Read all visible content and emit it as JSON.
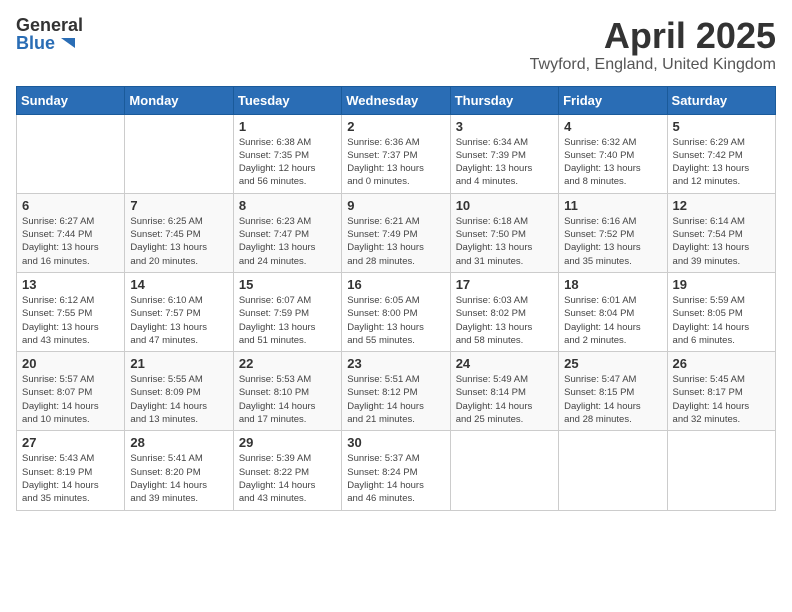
{
  "header": {
    "logo_general": "General",
    "logo_blue": "Blue",
    "month_title": "April 2025",
    "location": "Twyford, England, United Kingdom"
  },
  "calendar": {
    "days_of_week": [
      "Sunday",
      "Monday",
      "Tuesday",
      "Wednesday",
      "Thursday",
      "Friday",
      "Saturday"
    ],
    "weeks": [
      [
        {
          "day": "",
          "info": ""
        },
        {
          "day": "",
          "info": ""
        },
        {
          "day": "1",
          "info": "Sunrise: 6:38 AM\nSunset: 7:35 PM\nDaylight: 12 hours\nand 56 minutes."
        },
        {
          "day": "2",
          "info": "Sunrise: 6:36 AM\nSunset: 7:37 PM\nDaylight: 13 hours\nand 0 minutes."
        },
        {
          "day": "3",
          "info": "Sunrise: 6:34 AM\nSunset: 7:39 PM\nDaylight: 13 hours\nand 4 minutes."
        },
        {
          "day": "4",
          "info": "Sunrise: 6:32 AM\nSunset: 7:40 PM\nDaylight: 13 hours\nand 8 minutes."
        },
        {
          "day": "5",
          "info": "Sunrise: 6:29 AM\nSunset: 7:42 PM\nDaylight: 13 hours\nand 12 minutes."
        }
      ],
      [
        {
          "day": "6",
          "info": "Sunrise: 6:27 AM\nSunset: 7:44 PM\nDaylight: 13 hours\nand 16 minutes."
        },
        {
          "day": "7",
          "info": "Sunrise: 6:25 AM\nSunset: 7:45 PM\nDaylight: 13 hours\nand 20 minutes."
        },
        {
          "day": "8",
          "info": "Sunrise: 6:23 AM\nSunset: 7:47 PM\nDaylight: 13 hours\nand 24 minutes."
        },
        {
          "day": "9",
          "info": "Sunrise: 6:21 AM\nSunset: 7:49 PM\nDaylight: 13 hours\nand 28 minutes."
        },
        {
          "day": "10",
          "info": "Sunrise: 6:18 AM\nSunset: 7:50 PM\nDaylight: 13 hours\nand 31 minutes."
        },
        {
          "day": "11",
          "info": "Sunrise: 6:16 AM\nSunset: 7:52 PM\nDaylight: 13 hours\nand 35 minutes."
        },
        {
          "day": "12",
          "info": "Sunrise: 6:14 AM\nSunset: 7:54 PM\nDaylight: 13 hours\nand 39 minutes."
        }
      ],
      [
        {
          "day": "13",
          "info": "Sunrise: 6:12 AM\nSunset: 7:55 PM\nDaylight: 13 hours\nand 43 minutes."
        },
        {
          "day": "14",
          "info": "Sunrise: 6:10 AM\nSunset: 7:57 PM\nDaylight: 13 hours\nand 47 minutes."
        },
        {
          "day": "15",
          "info": "Sunrise: 6:07 AM\nSunset: 7:59 PM\nDaylight: 13 hours\nand 51 minutes."
        },
        {
          "day": "16",
          "info": "Sunrise: 6:05 AM\nSunset: 8:00 PM\nDaylight: 13 hours\nand 55 minutes."
        },
        {
          "day": "17",
          "info": "Sunrise: 6:03 AM\nSunset: 8:02 PM\nDaylight: 13 hours\nand 58 minutes."
        },
        {
          "day": "18",
          "info": "Sunrise: 6:01 AM\nSunset: 8:04 PM\nDaylight: 14 hours\nand 2 minutes."
        },
        {
          "day": "19",
          "info": "Sunrise: 5:59 AM\nSunset: 8:05 PM\nDaylight: 14 hours\nand 6 minutes."
        }
      ],
      [
        {
          "day": "20",
          "info": "Sunrise: 5:57 AM\nSunset: 8:07 PM\nDaylight: 14 hours\nand 10 minutes."
        },
        {
          "day": "21",
          "info": "Sunrise: 5:55 AM\nSunset: 8:09 PM\nDaylight: 14 hours\nand 13 minutes."
        },
        {
          "day": "22",
          "info": "Sunrise: 5:53 AM\nSunset: 8:10 PM\nDaylight: 14 hours\nand 17 minutes."
        },
        {
          "day": "23",
          "info": "Sunrise: 5:51 AM\nSunset: 8:12 PM\nDaylight: 14 hours\nand 21 minutes."
        },
        {
          "day": "24",
          "info": "Sunrise: 5:49 AM\nSunset: 8:14 PM\nDaylight: 14 hours\nand 25 minutes."
        },
        {
          "day": "25",
          "info": "Sunrise: 5:47 AM\nSunset: 8:15 PM\nDaylight: 14 hours\nand 28 minutes."
        },
        {
          "day": "26",
          "info": "Sunrise: 5:45 AM\nSunset: 8:17 PM\nDaylight: 14 hours\nand 32 minutes."
        }
      ],
      [
        {
          "day": "27",
          "info": "Sunrise: 5:43 AM\nSunset: 8:19 PM\nDaylight: 14 hours\nand 35 minutes."
        },
        {
          "day": "28",
          "info": "Sunrise: 5:41 AM\nSunset: 8:20 PM\nDaylight: 14 hours\nand 39 minutes."
        },
        {
          "day": "29",
          "info": "Sunrise: 5:39 AM\nSunset: 8:22 PM\nDaylight: 14 hours\nand 43 minutes."
        },
        {
          "day": "30",
          "info": "Sunrise: 5:37 AM\nSunset: 8:24 PM\nDaylight: 14 hours\nand 46 minutes."
        },
        {
          "day": "",
          "info": ""
        },
        {
          "day": "",
          "info": ""
        },
        {
          "day": "",
          "info": ""
        }
      ]
    ]
  }
}
